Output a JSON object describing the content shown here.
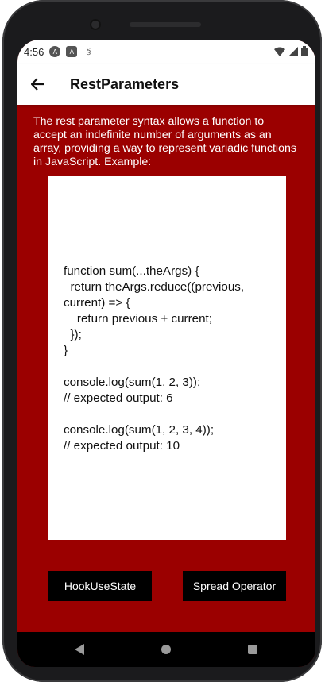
{
  "status_bar": {
    "time": "4:56",
    "icons": [
      "a-badge-icon",
      "a-square-icon",
      "s-icon"
    ],
    "right_icons": [
      "wifi-icon",
      "signal-icon",
      "battery-icon"
    ]
  },
  "app_bar": {
    "title": "RestParameters",
    "back_icon": "arrow-left-icon"
  },
  "content": {
    "intro": "The rest parameter syntax allows a function to accept an indefinite number of arguments as an array, providing a way to represent variadic functions in JavaScript. Example:",
    "code": "function sum(...theArgs) {\n  return theArgs.reduce((previous, current) => {\n    return previous + current;\n  });\n}\n\nconsole.log(sum(1, 2, 3));\n// expected output: 6\n\nconsole.log(sum(1, 2, 3, 4));\n// expected output: 10"
  },
  "buttons": {
    "left_label": "HookUseState",
    "right_label": "Spread Operator"
  },
  "nav_bar": {
    "icons": [
      "back-triangle-icon",
      "home-circle-icon",
      "recents-square-icon"
    ]
  },
  "colors": {
    "background": "#9b0000",
    "button": "#000000",
    "code_box": "#ffffff"
  }
}
